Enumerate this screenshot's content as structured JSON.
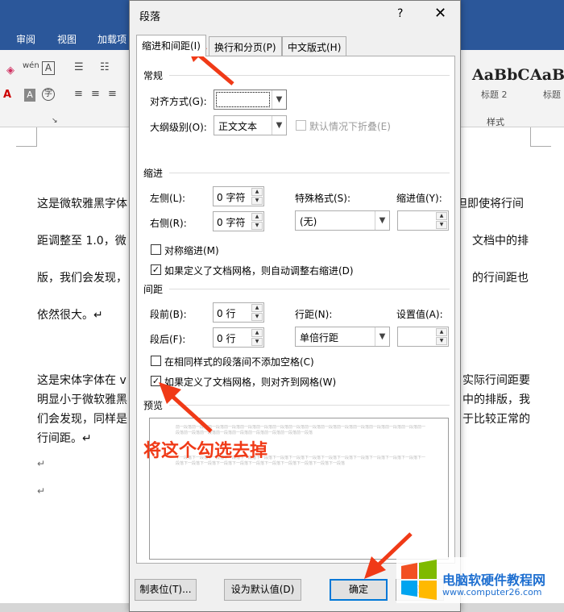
{
  "ribbon": {
    "tabs": [
      "审阅",
      "视图",
      "加载项"
    ],
    "style_samples": [
      {
        "sample": "AaBbC",
        "name": "标题 2"
      },
      {
        "sample": "AaBb",
        "name": "标题"
      }
    ],
    "styles_group_label": "样式"
  },
  "document": {
    "paragraph1": {
      "line1_left": "这是微软雅黑字体",
      "line1_right": "但即使将行间",
      "line2_left": "距调整至 1.0，微",
      "line2_right": "文档中的排",
      "line3_left": "版，我们会发现，",
      "line3_right": "的行间距也",
      "line4": "依然很大。↵"
    },
    "paragraph2": {
      "line1_left": "这是宋体字体在 v",
      "line1_right": "实际行间距要",
      "line2_left": "明显小于微软雅黑",
      "line2_right": "中的排版，我",
      "line3_left": "们会发现，同样是",
      "line3_right": "于比较正常的",
      "line4": "行间距。↵"
    },
    "empty_marks": [
      "↵",
      "↵"
    ]
  },
  "dialog": {
    "title": "段落",
    "help": "?",
    "close": "✕",
    "tabs": [
      "缩进和间距(I)",
      "换行和分页(P)",
      "中文版式(H)"
    ],
    "general": {
      "section": "常规",
      "alignment_label": "对齐方式(G):",
      "alignment_value": "",
      "outline_label": "大纲级别(O):",
      "outline_value": "正文文本",
      "collapse_label": "默认情况下折叠(E)"
    },
    "indent": {
      "section": "缩进",
      "left_label": "左侧(L):",
      "left_value": "0 字符",
      "right_label": "右侧(R):",
      "right_value": "0 字符",
      "special_label": "特殊格式(S):",
      "special_value": "(无)",
      "by_label": "缩进值(Y):",
      "by_value": "",
      "mirror_label": "对称缩进(M)",
      "auto_adjust_label": "如果定义了文档网格，则自动调整右缩进(D)"
    },
    "spacing": {
      "section": "间距",
      "before_label": "段前(B):",
      "before_value": "0 行",
      "after_label": "段后(F):",
      "after_value": "0 行",
      "line_spacing_label": "行距(N):",
      "line_spacing_value": "单倍行距",
      "at_label": "设置值(A):",
      "at_value": "",
      "no_space_label": "在相同样式的段落间不添加空格(C)",
      "snap_grid_label": "如果定义了文档网格，则对齐到网格(W)"
    },
    "preview": {
      "section": "预览",
      "prev_text": "前一段落前一段落前一段落前一段落前一段落前一段落前一段落前一段落前一段落前一段落前一段落前一段落前一段落前一段落前一段落前一段落前一段落前一段落前一段落前一段落前一段落前一段落前一段落前一段落",
      "next_text": "下一段落下一段落下一段落下一段落下一段落下一段落下一段落下一段落下一段落下一段落下一段落下一段落下一段落下一段落下一段落下一段落下一段落下一段落下一段落下一段落下一段落下一段落下一段落下一段落下一段落下一段落"
    },
    "buttons": {
      "tabs": "制表位(T)...",
      "set_default": "设为默认值(D)",
      "ok": "确定",
      "cancel": "取消"
    }
  },
  "annotation": {
    "text": "将这个勾选去掉",
    "color": "#f03a17"
  },
  "watermark": {
    "title": "电脑软硬件教程网",
    "url": "www.computer26.com",
    "logo_colors": [
      "#f25022",
      "#7fba00",
      "#00a4ef",
      "#ffb900"
    ]
  }
}
